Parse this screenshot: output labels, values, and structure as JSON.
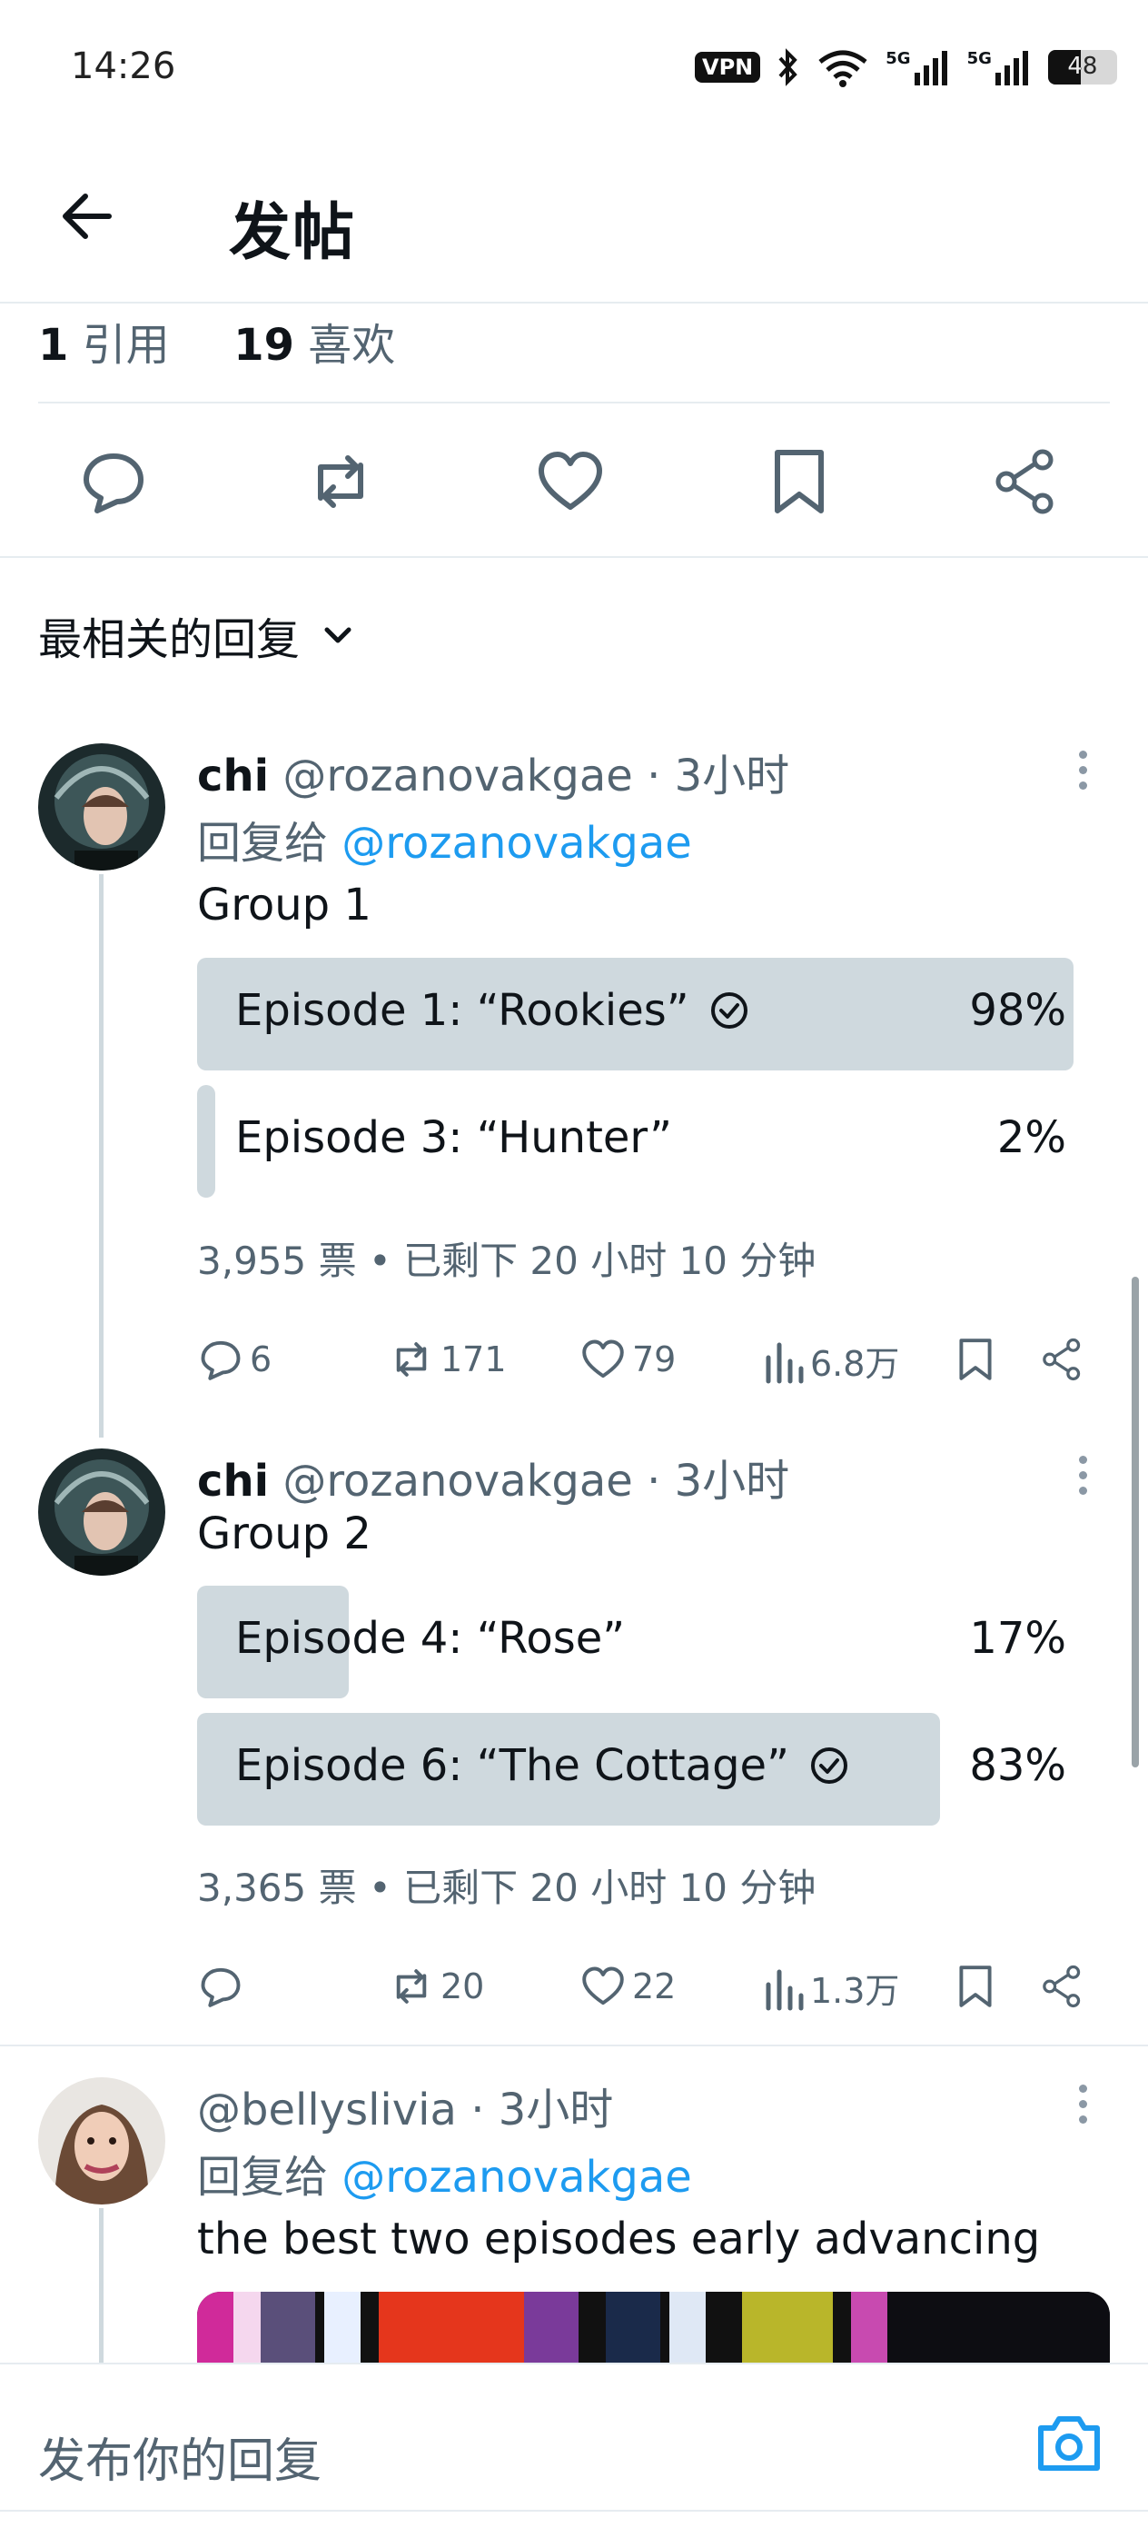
{
  "status": {
    "time": "14:26",
    "vpn": "VPN",
    "net1": "5G",
    "net2": "5G",
    "battery": "48"
  },
  "header": {
    "title": "发帖"
  },
  "stats": {
    "quotes_count": "1",
    "quotes_label": "引用",
    "likes_count": "19",
    "likes_label": "喜欢"
  },
  "sort": {
    "label": "最相关的回复"
  },
  "tweets": [
    {
      "name": "chi",
      "handle": "@rozanovakgae",
      "time": "3小时",
      "reply_prefix": "回复给",
      "reply_to": "@rozanovakgae",
      "text": "Group 1",
      "poll": [
        {
          "label": "Episode 1: “Rookies”",
          "percent": "98%",
          "fill": 0.98,
          "winner": true
        },
        {
          "label": "Episode 3: “Hunter”",
          "percent": "2%",
          "fill": 0.02,
          "winner": false
        }
      ],
      "poll_info": "3,955 票 • 已剩下 20 小时 10 分钟",
      "actions": {
        "replies": "6",
        "reposts": "171",
        "likes": "79",
        "views": "6.8万"
      }
    },
    {
      "name": "chi",
      "handle": "@rozanovakgae",
      "time": "3小时",
      "text": "Group 2",
      "poll": [
        {
          "label": "Episode 4: “Rose”",
          "percent": "17%",
          "fill": 0.17,
          "winner": false
        },
        {
          "label": "Episode 6: “The Cottage”",
          "percent": "83%",
          "fill": 0.83,
          "winner": true
        }
      ],
      "poll_info": "3,365 票 • 已剩下 20 小时 10 分钟",
      "actions": {
        "replies": "",
        "reposts": "20",
        "likes": "22",
        "views": "1.3万"
      }
    },
    {
      "handle": "@bellyslivia",
      "time": "3小时",
      "reply_prefix": "回复给",
      "reply_to": "@rozanovakgae",
      "text": "the best two episodes early advancing"
    }
  ],
  "reply_bar": {
    "placeholder": "发布你的回复"
  },
  "colors": {
    "accent": "#1d9bf0",
    "poll_fill": "#cfd9de",
    "muted": "#536471"
  }
}
